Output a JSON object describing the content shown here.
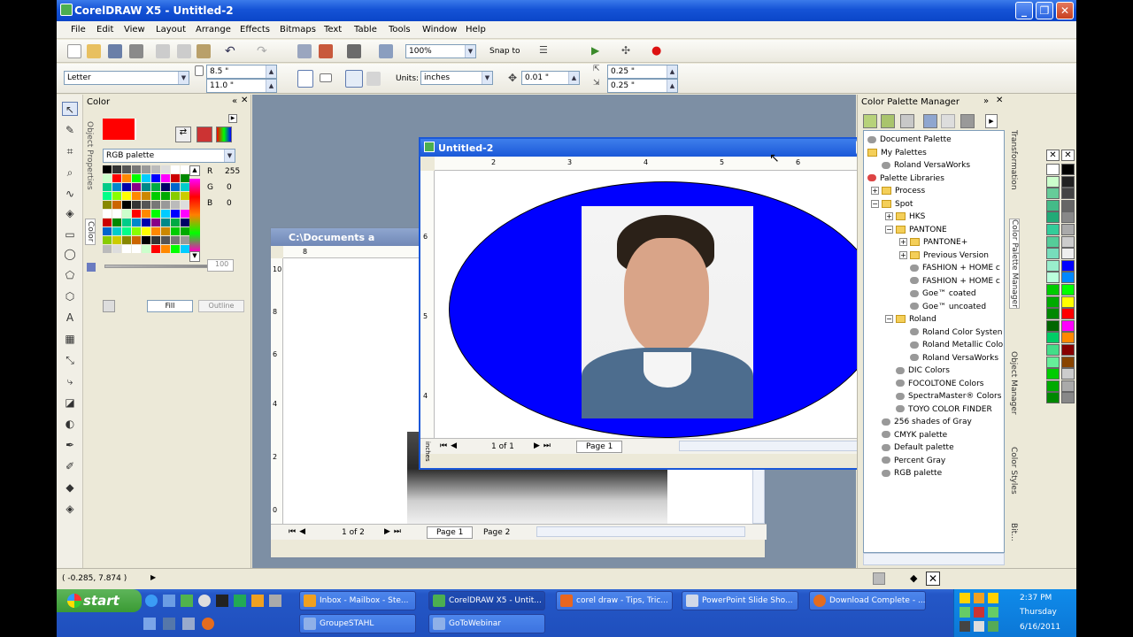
{
  "window": {
    "title": "CorelDRAW X5 - Untitled-2",
    "min": "_",
    "max": "❐",
    "close": "✕"
  },
  "menu": [
    "File",
    "Edit",
    "View",
    "Layout",
    "Arrange",
    "Effects",
    "Bitmaps",
    "Text",
    "Table",
    "Tools",
    "Window",
    "Help"
  ],
  "toolbar": {
    "zoom": "100%",
    "snap": "Snap to"
  },
  "propbar": {
    "paper": "Letter",
    "width": "8.5 \"",
    "height": "11.0 \"",
    "units_label": "Units:",
    "units": "inches",
    "nudge": "0.01 \"",
    "dup_x": "0.25 \"",
    "dup_y": "0.25 \""
  },
  "color_dock": {
    "title": "Color",
    "palette": "RGB palette",
    "r_label": "R",
    "g_label": "G",
    "b_label": "B",
    "r": "255",
    "g": "0",
    "b": "0",
    "slider": "100",
    "fill": "Fill",
    "outline": "Outline",
    "side_tab1": "Object Properties",
    "side_tab2": "Color",
    "fill_color": "#ff0000"
  },
  "doc_front": {
    "title": "Untitled-2",
    "ruler_unit": "inches",
    "ruler_ticks": [
      "2",
      "3",
      "4",
      "5",
      "6",
      "7"
    ],
    "ruler_v": [
      "6",
      "5",
      "4"
    ],
    "pages": "1 of 1",
    "page_tab": "Page 1",
    "ellipse_color": "#0000ff"
  },
  "doc_back": {
    "title": "C:\\Documents a",
    "ruler_h": "8",
    "ruler_v": [
      "10",
      "8",
      "6",
      "4",
      "2",
      "0"
    ],
    "ruler_unit": "inches",
    "pages": "1 of 2",
    "tabs": [
      "Page 1",
      "Page 2"
    ]
  },
  "palette_manager": {
    "title": "Color Palette Manager",
    "items": [
      {
        "label": "Document Palette",
        "level": 0,
        "icon": "pal"
      },
      {
        "label": "My Palettes",
        "level": 0,
        "icon": "folder"
      },
      {
        "label": "Roland VersaWorks",
        "level": 1,
        "icon": "pal"
      },
      {
        "label": "Palette Libraries",
        "level": 0,
        "icon": "lib"
      },
      {
        "label": "Process",
        "level": 1,
        "icon": "folder",
        "exp": "+"
      },
      {
        "label": "Spot",
        "level": 1,
        "icon": "folder",
        "exp": "−"
      },
      {
        "label": "HKS",
        "level": 2,
        "icon": "folder",
        "exp": "+"
      },
      {
        "label": "PANTONE",
        "level": 2,
        "icon": "folder",
        "exp": "−"
      },
      {
        "label": "PANTONE+",
        "level": 3,
        "icon": "folder",
        "exp": "+"
      },
      {
        "label": "Previous Version",
        "level": 3,
        "icon": "folder",
        "exp": "+"
      },
      {
        "label": "FASHION + HOME c",
        "level": 3,
        "icon": "pal"
      },
      {
        "label": "FASHION + HOME c",
        "level": 3,
        "icon": "pal"
      },
      {
        "label": "Goe™ coated",
        "level": 3,
        "icon": "pal"
      },
      {
        "label": "Goe™ uncoated",
        "level": 3,
        "icon": "pal"
      },
      {
        "label": "Roland",
        "level": 2,
        "icon": "folder",
        "exp": "−"
      },
      {
        "label": "Roland Color Systen",
        "level": 3,
        "icon": "pal"
      },
      {
        "label": "Roland Metallic Colo",
        "level": 3,
        "icon": "pal"
      },
      {
        "label": "Roland VersaWorks",
        "level": 3,
        "icon": "pal"
      },
      {
        "label": "DIC Colors",
        "level": 2,
        "icon": "pal"
      },
      {
        "label": "FOCOLTONE Colors",
        "level": 2,
        "icon": "pal"
      },
      {
        "label": "SpectraMaster® Colors",
        "level": 2,
        "icon": "pal"
      },
      {
        "label": "TOYO COLOR FINDER",
        "level": 2,
        "icon": "pal"
      },
      {
        "label": "256 shades of Gray",
        "level": 1,
        "icon": "pal"
      },
      {
        "label": "CMYK palette",
        "level": 1,
        "icon": "pal"
      },
      {
        "label": "Default palette",
        "level": 1,
        "icon": "pal"
      },
      {
        "label": "Percent Gray",
        "level": 1,
        "icon": "pal"
      },
      {
        "label": "RGB palette",
        "level": 1,
        "icon": "pal"
      }
    ]
  },
  "vtabs": [
    "Transformation",
    "Color Palette Manager",
    "Object Manager",
    "Color Styles",
    "Bit..."
  ],
  "status": {
    "coords": "( -0.285, 7.874 )"
  },
  "taskbar": {
    "start": "start",
    "tasks": [
      "Inbox - Mailbox - Ste...",
      "CorelDRAW X5 - Untit...",
      "corel draw - Tips, Tric...",
      "PowerPoint Slide Sho...",
      "Download Complete - ..."
    ],
    "tasks2": [
      "GroupeSTAHL",
      "GoToWebinar"
    ],
    "time": "2:37 PM",
    "day": "Thursday",
    "date": "6/16/2011"
  }
}
